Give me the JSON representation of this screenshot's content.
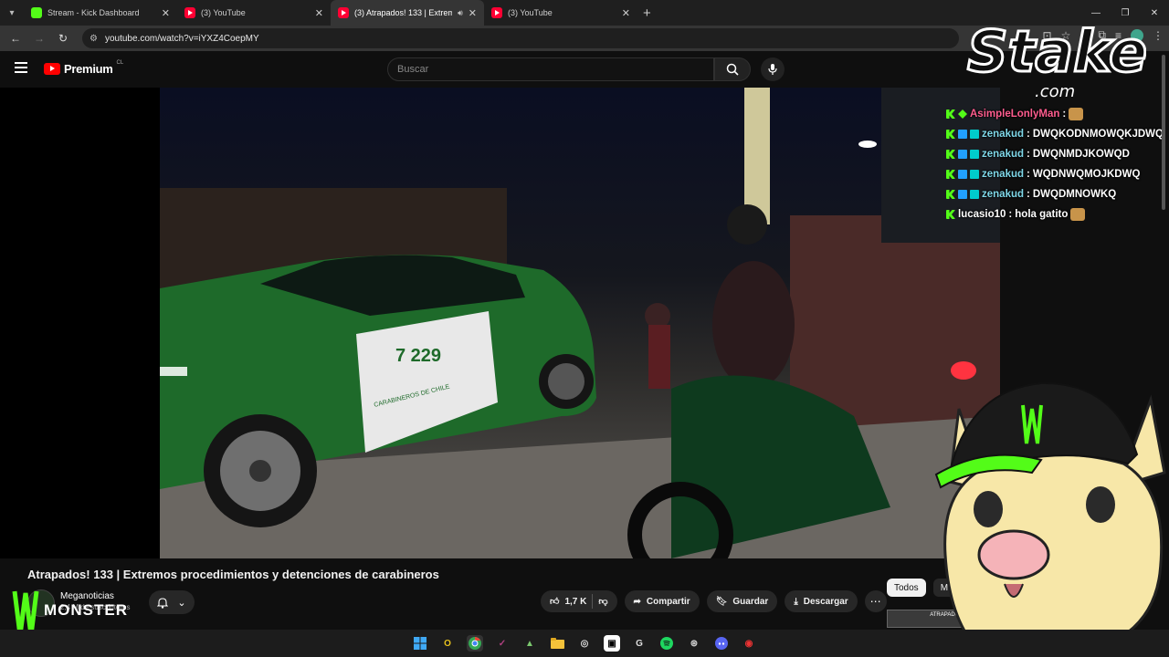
{
  "browser": {
    "tabs": [
      {
        "title": "Stream - Kick Dashboard",
        "favicon": "kick"
      },
      {
        "title": "(3) YouTube",
        "favicon": "youtube"
      },
      {
        "title": "(3) Atrapados! 133 | Extrem",
        "favicon": "youtube",
        "active": true,
        "audio": true
      },
      {
        "title": "(3) YouTube",
        "favicon": "youtube"
      }
    ],
    "url": "youtube.com/watch?v=iYXZ4CoepMY"
  },
  "youtube": {
    "brand": "Premium",
    "region": "CL",
    "search_placeholder": "Buscar",
    "video": {
      "title": "Atrapados! 133 | Extremos procedimientos y detenciones de carabineros",
      "channel": "Meganoticias",
      "subscribers": "2,4 M de suscriptores",
      "likes": "1,7 K"
    },
    "actions": {
      "share": "Compartir",
      "save": "Guardar",
      "download": "Descargar"
    },
    "chips": [
      "Todos",
      "M"
    ],
    "thumb_label": "ATRAPADOS!"
  },
  "scene": {
    "car_unit_number": "7 229",
    "car_text": "CARABINEROS DE CHILE"
  },
  "chat": [
    {
      "user": "AsimpleLonlyMan",
      "badges": [
        "kick",
        "diamond"
      ],
      "message": "",
      "emote": true,
      "user_color": "#ff5d8f"
    },
    {
      "user": "zenakud",
      "badges": [
        "kick",
        "blue",
        "cyan"
      ],
      "message": "DWQKODNMOWQKJDWQ",
      "user_color": "#7fd7e8"
    },
    {
      "user": "zenakud",
      "badges": [
        "kick",
        "blue",
        "cyan"
      ],
      "message": "DWQNMDJKOWQD",
      "user_color": "#7fd7e8"
    },
    {
      "user": "zenakud",
      "badges": [
        "kick",
        "blue",
        "cyan"
      ],
      "message": "WQDNWQMOJKDWQ",
      "user_color": "#7fd7e8"
    },
    {
      "user": "zenakud",
      "badges": [
        "kick",
        "blue",
        "cyan"
      ],
      "message": "DWQDMNOWKQ",
      "user_color": "#7fd7e8"
    },
    {
      "user": "lucasio10",
      "badges": [
        "kick"
      ],
      "message": "hola gatito",
      "emote": true,
      "user_color": "#ffffff"
    }
  ],
  "overlay": {
    "stake_text": "Stake",
    "stake_sub": ".com",
    "monster_text": "MONSTER"
  },
  "taskbar": [
    "windows",
    "opera",
    "chrome",
    "kick-studio",
    "app",
    "files",
    "obs",
    "capcut",
    "gaming",
    "spotify",
    "steam",
    "discord",
    "app2"
  ],
  "colors": {
    "kick_green": "#53fc18",
    "youtube_red": "#ff0000",
    "carabineros_green": "#1e6a2a"
  }
}
